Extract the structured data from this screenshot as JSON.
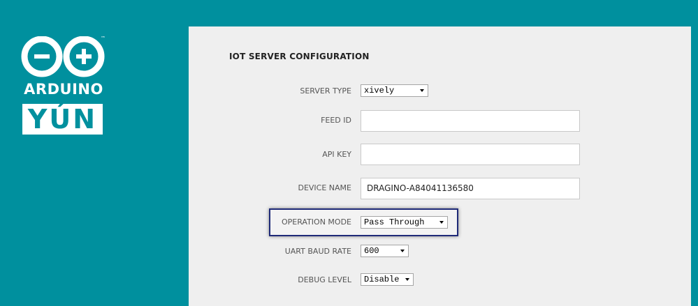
{
  "brand": {
    "wordmark": "ARDUINO",
    "product": "YÚN",
    "tm": "™"
  },
  "page": {
    "title": "IOT SERVER CONFIGURATION"
  },
  "form": {
    "server_type": {
      "label": "SERVER TYPE",
      "value": "xively"
    },
    "feed_id": {
      "label": "FEED ID",
      "value": ""
    },
    "api_key": {
      "label": "API KEY",
      "value": ""
    },
    "device_name": {
      "label": "DEVICE NAME",
      "value": "DRAGINO-A84041136580"
    },
    "operation_mode": {
      "label": "OPERATION MODE",
      "value": "Pass Through"
    },
    "uart_baud_rate": {
      "label": "UART BAUD RATE",
      "value": "600"
    },
    "debug_level": {
      "label": "DEBUG LEVEL",
      "value": "Disable"
    }
  },
  "colors": {
    "background": "#00909e",
    "panel": "#efefef",
    "highlight_border": "#1f2a78"
  }
}
